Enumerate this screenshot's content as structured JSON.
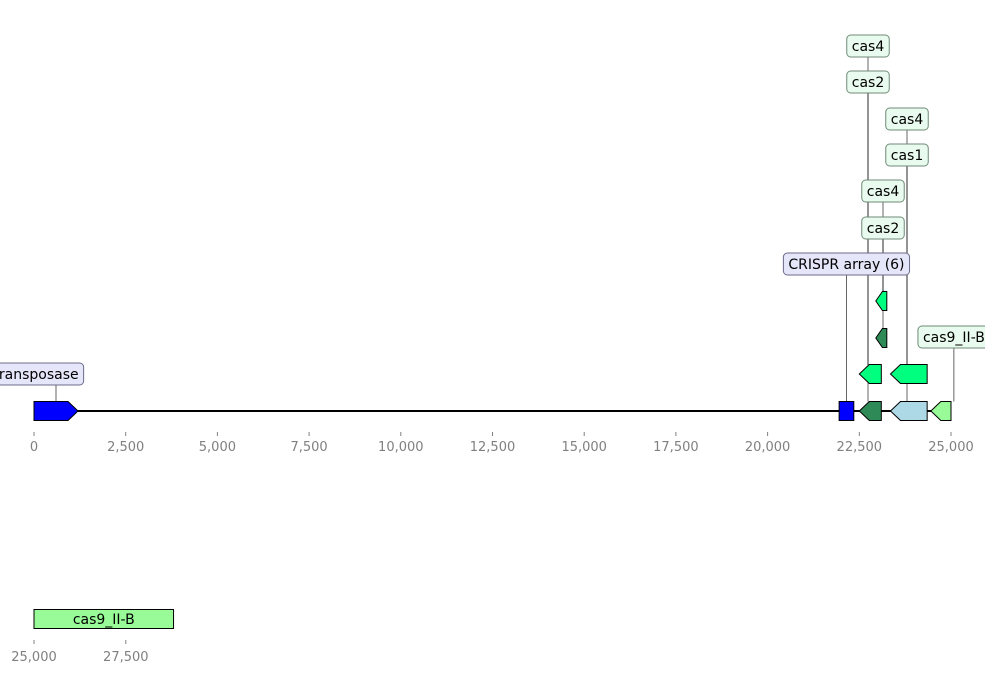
{
  "colors": {
    "transposase": "#0000ff",
    "crispr_array": "#0000ff",
    "cas2": "#2e8b57",
    "cas1": "#add8e6",
    "cas4": "#00ff7f",
    "cas9_II_B": "#98fb98",
    "label_box_blue": "#e6e6fa",
    "label_box_green": "#e9fbee",
    "axis_tick": "#808080"
  },
  "tracks": [
    {
      "range": [
        0,
        25000
      ],
      "ticks": [
        "0",
        "2,500",
        "5,000",
        "7,500",
        "10,000",
        "12,500",
        "15,000",
        "17,500",
        "20,000",
        "22,500",
        "25,000"
      ],
      "features": [
        {
          "label": "transposase",
          "start": 0,
          "end": 1200,
          "strand": 1,
          "color": "#0000ff",
          "row": 0,
          "box": "#e6e6fa"
        },
        {
          "label": "CRISPR array (6)",
          "start": 21950,
          "end": 22350,
          "strand": 0,
          "color": "#0000ff",
          "row": 0,
          "box": "#e6e6fa"
        },
        {
          "label": "cas2",
          "start": 22500,
          "end": 23100,
          "strand": -1,
          "color": "#2e8b57",
          "row": 0,
          "box": "#e9fbee"
        },
        {
          "label": "cas4",
          "start": 22500,
          "end": 23100,
          "strand": -1,
          "color": "#00ff7f",
          "row": 1,
          "box": "#e9fbee"
        },
        {
          "label": "cas2",
          "start": 22950,
          "end": 23250,
          "strand": -1,
          "color": "#2e8b57",
          "row": 2,
          "box": "#e9fbee"
        },
        {
          "label": "cas4",
          "start": 22950,
          "end": 23250,
          "strand": -1,
          "color": "#00ff7f",
          "row": 3,
          "box": "#e9fbee"
        },
        {
          "label": "cas1",
          "start": 23350,
          "end": 24350,
          "strand": -1,
          "color": "#add8e6",
          "row": 0,
          "box": "#e9fbee"
        },
        {
          "label": "cas4",
          "start": 23350,
          "end": 24350,
          "strand": -1,
          "color": "#00ff7f",
          "row": 1,
          "box": "#e9fbee"
        },
        {
          "label": "cas9_II-B",
          "start": 24450,
          "end": 25000,
          "strand": -1,
          "color": "#98fb98",
          "row": 0,
          "box": "#e9fbee"
        }
      ]
    },
    {
      "range": [
        25000,
        30000
      ],
      "ticks": [
        "25,000",
        "27,500"
      ],
      "features": [
        {
          "label": "cas9_II-B",
          "start": 25000,
          "end": 28800,
          "strand": 0,
          "color": "#98fb98",
          "row": 0,
          "inline": true
        }
      ]
    }
  ]
}
